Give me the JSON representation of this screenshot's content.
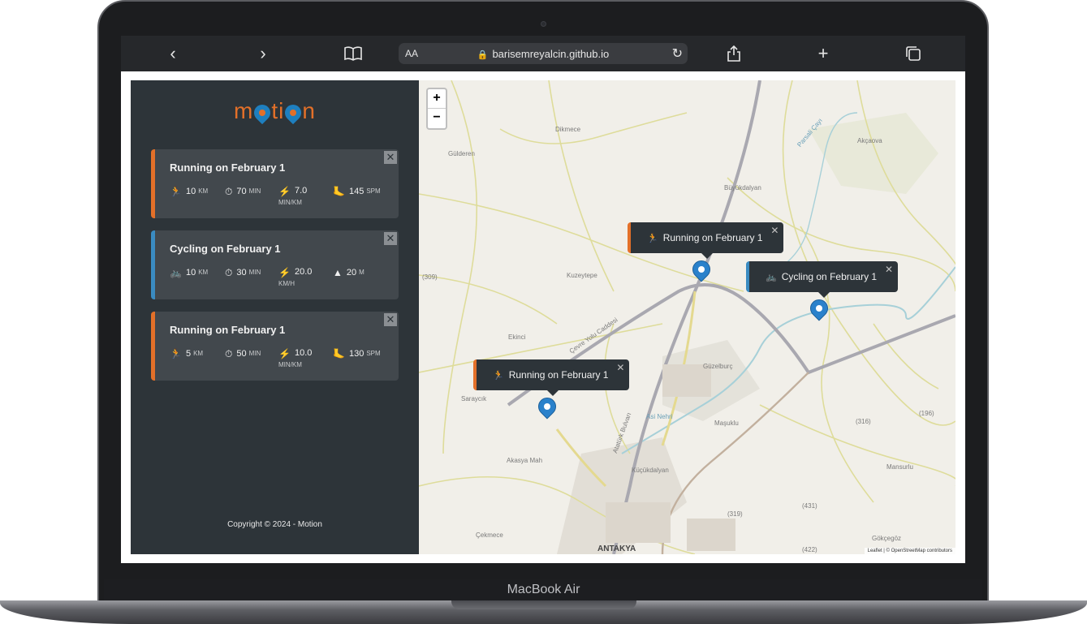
{
  "device": {
    "label": "MacBook Air"
  },
  "browser": {
    "text_size_label": "AA",
    "url": "barisemreyalcin.github.io"
  },
  "app": {
    "logo": {
      "before": "m",
      "middle": "ti",
      "after": "n"
    },
    "copyright": "Copyright © 2024 - Motion",
    "colors": {
      "running": "#e37029",
      "cycling": "#3a8bc1",
      "sidebar": "#2d3439",
      "card": "#42484d",
      "marker": "#2a81cb"
    }
  },
  "workouts": [
    {
      "type": "running",
      "title": "Running on February 1",
      "distance": {
        "icon": "running-icon",
        "value": "10",
        "unit": "KM"
      },
      "duration": {
        "icon": "stopwatch-icon",
        "value": "70",
        "unit": "MIN"
      },
      "pace": {
        "icon": "lightning-icon",
        "value": "7.0",
        "unit": "MIN/KM"
      },
      "cadence": {
        "icon": "footprint-icon",
        "value": "145",
        "unit": "SPM"
      }
    },
    {
      "type": "cycling",
      "title": "Cycling on February 1",
      "distance": {
        "icon": "bicycle-icon",
        "value": "10",
        "unit": "KM"
      },
      "duration": {
        "icon": "stopwatch-icon",
        "value": "30",
        "unit": "MIN"
      },
      "speed": {
        "icon": "lightning-icon",
        "value": "20.0",
        "unit": "KM/H"
      },
      "elevation": {
        "icon": "mountain-icon",
        "value": "20",
        "unit": "M"
      }
    },
    {
      "type": "running",
      "title": "Running on February 1",
      "distance": {
        "icon": "running-icon",
        "value": "5",
        "unit": "KM"
      },
      "duration": {
        "icon": "stopwatch-icon",
        "value": "50",
        "unit": "MIN"
      },
      "pace": {
        "icon": "lightning-icon",
        "value": "10.0",
        "unit": "MIN/KM"
      },
      "cadence": {
        "icon": "footprint-icon",
        "value": "130",
        "unit": "SPM"
      }
    }
  ],
  "map": {
    "zoom_in": "+",
    "zoom_out": "−",
    "popups": [
      {
        "type": "running",
        "label": "Running on February 1"
      },
      {
        "type": "cycling",
        "label": "Cycling on February 1"
      },
      {
        "type": "running",
        "label": "Running on February 1"
      }
    ],
    "places": [
      "Dikmece",
      "Gülderen",
      "Kuzeytepe",
      "Ekinci",
      "Saraycık",
      "Akasya Mah",
      "Çekmece",
      "ANTAKYA",
      "Büyükdalyan",
      "Akçaova",
      "Güzelburç",
      "Maşuklu",
      "Küçükdalyan",
      "Mansurlu",
      "Gökçegöz",
      "Asi Nehri",
      "Atatürk Bulvarı",
      "Çevre Yolu Caddesi",
      "Parsali Çayı"
    ],
    "road_numbers": [
      "(309)",
      "(316)",
      "(196)",
      "(319)",
      "(431)",
      "(422)"
    ],
    "attribution": "Leaflet | © OpenStreetMap contributors"
  }
}
